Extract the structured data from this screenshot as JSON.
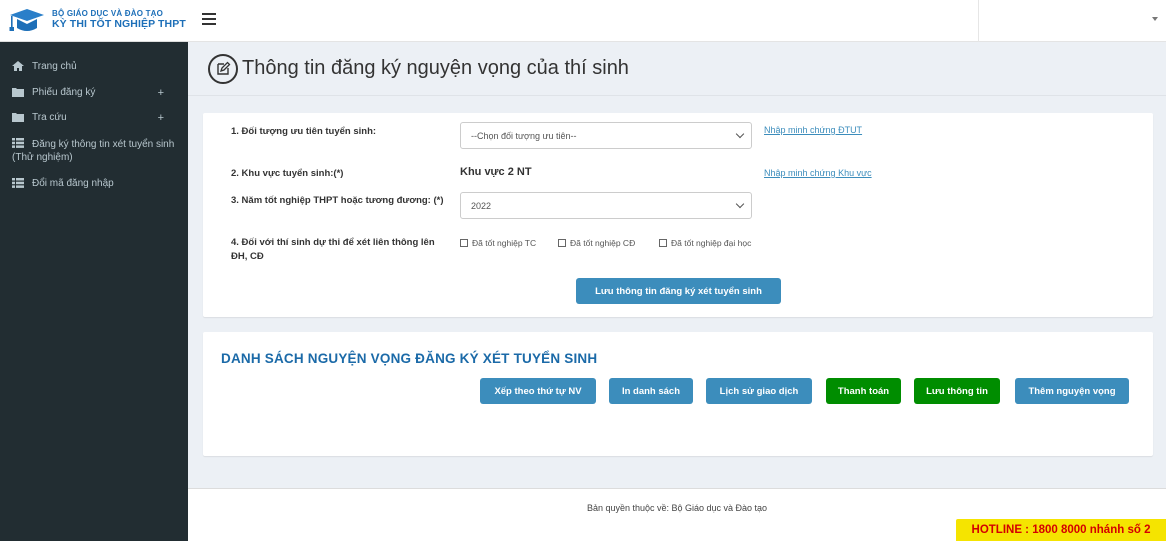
{
  "brand": {
    "line1": "BỘ GIÁO DỤC VÀ ĐÀO TẠO",
    "line2": "KỲ THI TỐT NGHIỆP THPT"
  },
  "sidebar": {
    "items": [
      {
        "label": "Trang chủ",
        "icon": "home-icon"
      },
      {
        "label": "Phiếu đăng ký",
        "icon": "folder-icon",
        "expand": "+"
      },
      {
        "label": "Tra cứu",
        "icon": "folder-icon",
        "expand": "+"
      },
      {
        "label": "Đăng ký thông tin xét tuyển sinh (Thử nghiệm)",
        "icon": "list-icon"
      },
      {
        "label": "Đổi mã đăng nhập",
        "icon": "list-icon"
      }
    ]
  },
  "page": {
    "title": "Thông tin đăng ký nguyện vọng của thí sinh"
  },
  "form": {
    "q1_label": "1. Đối tượng ưu tiên tuyển sinh:",
    "q1_select": "--Chọn đối tượng ưu tiên--",
    "q1_link": "Nhập minh chứng ĐTUT",
    "q2_label": "2. Khu vực tuyển sinh:(*)",
    "q2_value": "Khu vực 2 NT",
    "q2_link": "Nhập minh chứng Khu vực",
    "q3_label": "3. Năm tốt nghiệp THPT hoặc tương đương: (*)",
    "q3_select": "2022",
    "q4_label": "4. Đối với thí sinh dự thi để xét liên thông lên ĐH, CĐ",
    "q4_opt1": "Đã tốt nghiệp TC",
    "q4_opt2": "Đã tốt nghiệp CĐ",
    "q4_opt3": "Đã tốt nghiệp đại học",
    "save_button": "Lưu thông tin đăng ký xét tuyển sinh"
  },
  "list": {
    "title": "DANH SÁCH NGUYỆN VỌNG ĐĂNG KÝ XÉT TUYỂN SINH",
    "buttons": {
      "sort": "Xếp theo thứ tự NV",
      "print": "In danh sách",
      "history": "Lịch sử giao dịch",
      "pay": "Thanh toán",
      "save": "Lưu thông tin",
      "add": "Thêm nguyện vọng"
    }
  },
  "footer": {
    "copyright": "Bản quyền thuộc về: Bộ Giáo dục và Đào tạo"
  },
  "hotline": "HOTLINE : 1800 8000 nhánh số 2",
  "colors": {
    "sidebar_bg": "#222d32",
    "primary": "#3c8dbc",
    "success": "#008d00",
    "hotline_bg": "#f5e400",
    "hotline_text": "#d40000"
  }
}
